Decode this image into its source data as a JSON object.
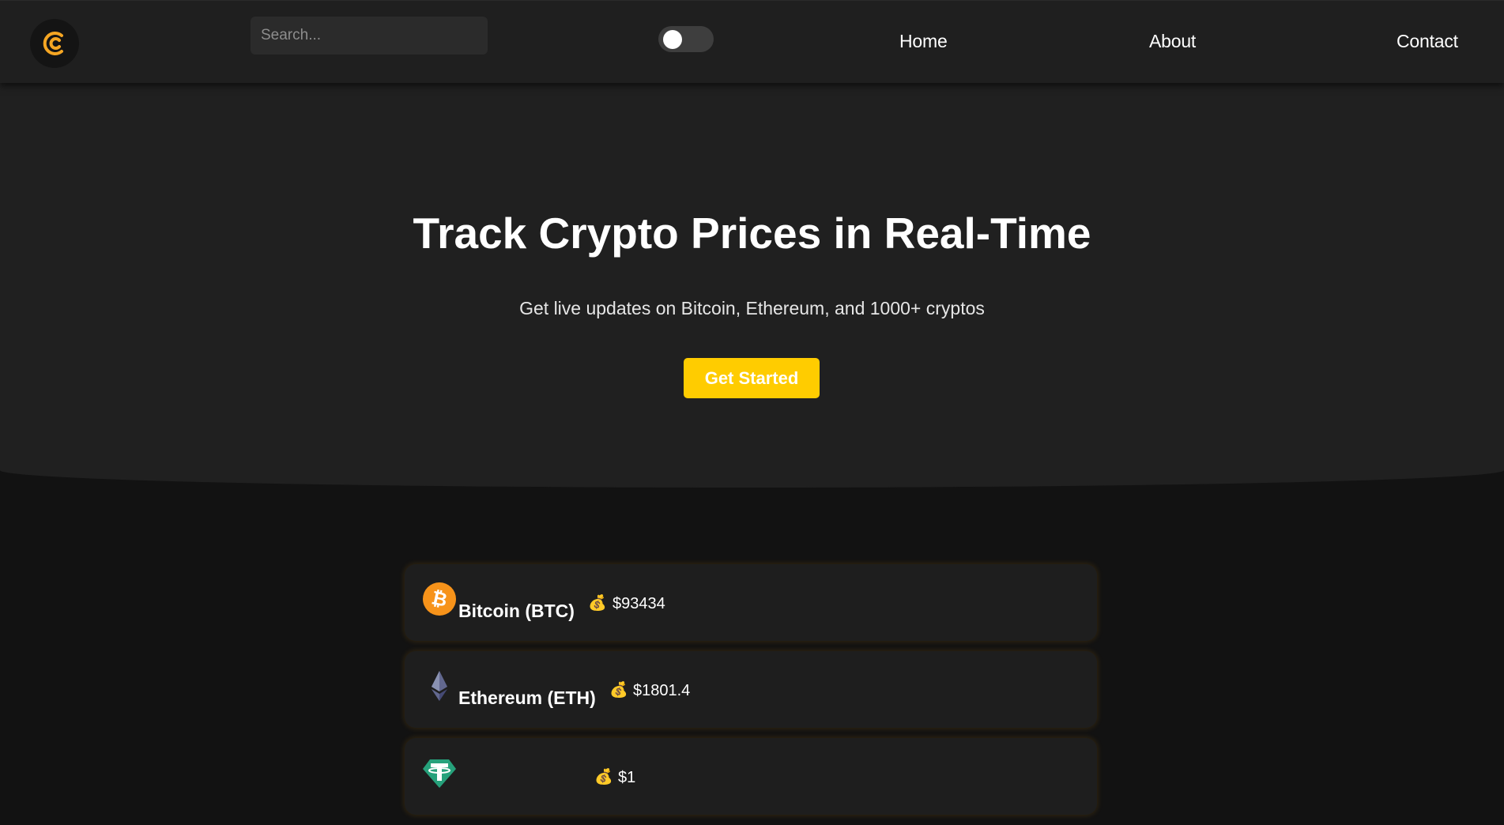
{
  "nav": {
    "logo_icon": "coin-c-logo-icon",
    "search_placeholder": "Search...",
    "theme_toggle_on": false,
    "links": [
      {
        "label": "Home"
      },
      {
        "label": "About"
      },
      {
        "label": "Contact"
      }
    ]
  },
  "hero": {
    "title": "Track Crypto Prices in Real-Time",
    "subtitle": "Get live updates on Bitcoin, Ethereum, and 1000+ cryptos",
    "cta_label": "Get Started"
  },
  "coins": [
    {
      "name": "Bitcoin (BTC)",
      "price": "$93434",
      "icon": "bitcoin-icon"
    },
    {
      "name": "Ethereum (ETH)",
      "price": "$1801.4",
      "icon": "ethereum-icon"
    },
    {
      "name": "",
      "price": "$1",
      "icon": "tether-icon"
    }
  ],
  "colors": {
    "accent": "#ffcc00",
    "bitcoin": "#f7931a",
    "tether": "#26a17b",
    "ethereum": "#62688f",
    "background": "#121212",
    "surface": "#1e1e1e"
  }
}
